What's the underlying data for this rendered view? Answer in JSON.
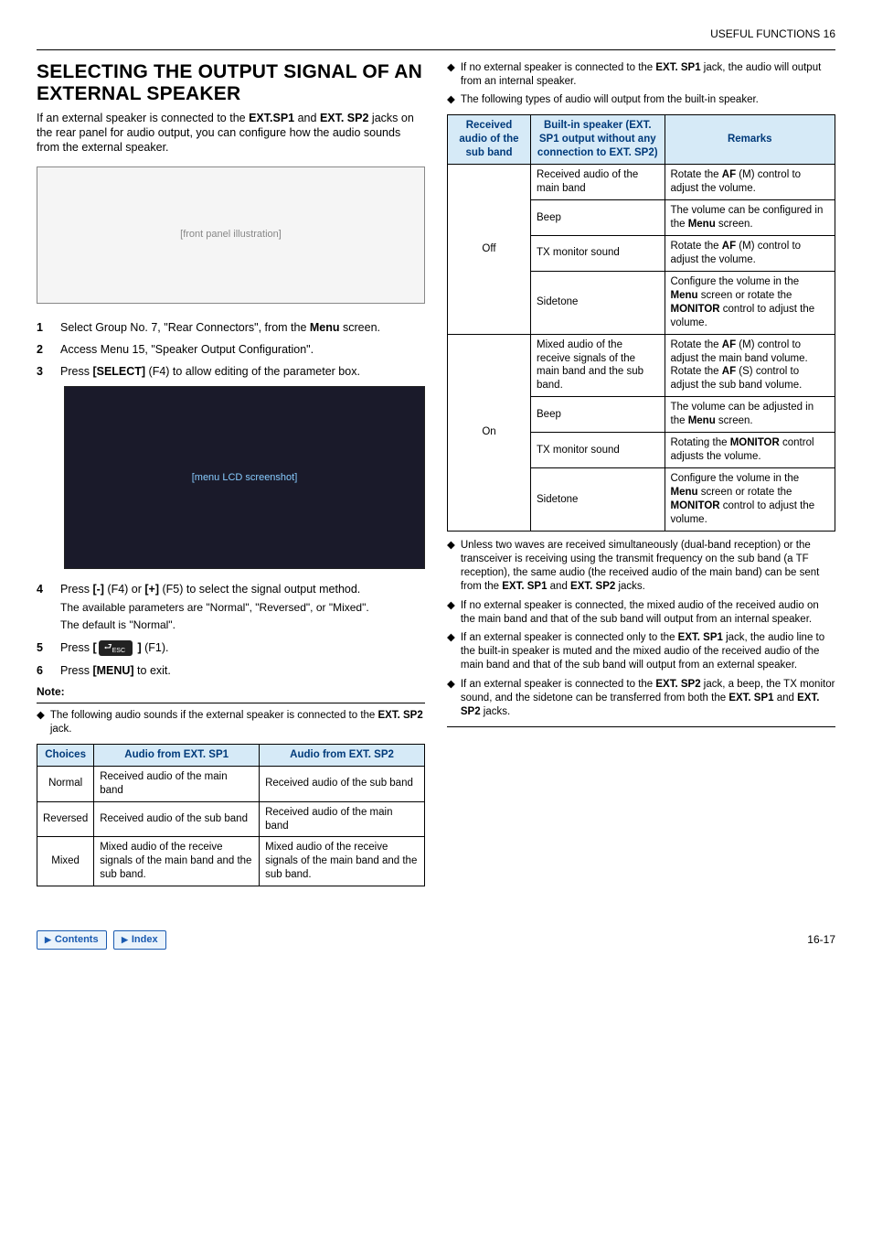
{
  "header": {
    "breadcrumb": "USEFUL FUNCTIONS 16"
  },
  "section_title": "SELECTING THE OUTPUT SIGNAL OF AN EXTERNAL SPEAKER",
  "intro": {
    "p1_a": "If an external speaker is connected to the ",
    "p1_b": "EXT.SP1",
    "p1_c": " and ",
    "p1_d": "EXT. SP2",
    "p1_e": " jacks on the rear panel for audio output, you can configure how the audio sounds from the external speaker."
  },
  "placeholders": {
    "panel": "[front panel illustration]",
    "lcd": "[menu LCD screenshot]"
  },
  "steps": [
    {
      "n": "1",
      "t_a": "Select Group No. 7, \"Rear Connectors\", from the ",
      "t_b": "Menu",
      "t_c": " screen."
    },
    {
      "n": "2",
      "t_a": "Access Menu 15, \"Speaker Output Configuration\"."
    },
    {
      "n": "3",
      "t_a": "Press ",
      "t_b": "[SELECT]",
      "t_c": " (F4) to allow editing of the parameter box."
    },
    {
      "n": "4",
      "t_a": "Press ",
      "t_b": "[-]",
      "t_c": " (F4) or ",
      "t_d": "[+]",
      "t_e": " (F5) to select the signal output method.",
      "sub1": "The available parameters are \"Normal\", \"Reversed\", or \"Mixed\".",
      "sub2": "The default is \"Normal\"."
    },
    {
      "n": "5",
      "t_a": "Press ",
      "t_b": "[",
      "t_c": " ]",
      "t_d": " (F1)."
    },
    {
      "n": "6",
      "t_a": "Press ",
      "t_b": "[MENU]",
      "t_c": " to exit."
    }
  ],
  "note_label": "Note:",
  "note_left": {
    "a": "The following audio sounds if the external speaker is connected to the ",
    "b": "EXT. SP2",
    "c": " jack."
  },
  "table1": {
    "h1": "Choices",
    "h2": "Audio from EXT. SP1",
    "h3": "Audio from EXT. SP2",
    "rows": [
      {
        "c1": "Normal",
        "c2": "Received audio of the main band",
        "c3": "Received audio of the sub band"
      },
      {
        "c1": "Reversed",
        "c2": "Received audio of the sub band",
        "c3": "Received audio of the main band"
      },
      {
        "c1": "Mixed",
        "c2": "Mixed audio of the receive signals of the main band and the sub band.",
        "c3": "Mixed audio of the receive signals of the main band and the sub band."
      }
    ]
  },
  "right_bullets_top": [
    {
      "a": "If no external speaker is connected to the ",
      "b": "EXT. SP1",
      "c": " jack, the audio will output from an internal speaker."
    },
    {
      "a": "The following types of audio will output from the built-in speaker."
    }
  ],
  "table2": {
    "h1": "Received audio of the sub band",
    "h2": "Built-in speaker (EXT. SP1 output without any connection to EXT. SP2)",
    "h3": "Remarks",
    "groups": [
      {
        "label": "Off",
        "rows": [
          {
            "c2": "Received audio of the main band",
            "r": {
              "a": "Rotate the ",
              "b": "AF",
              "c": " (M) control to adjust the volume."
            }
          },
          {
            "c2": "Beep",
            "r": {
              "a": "The volume can be configured in the ",
              "b": "Menu",
              "c": " screen."
            }
          },
          {
            "c2": "TX monitor sound",
            "r": {
              "a": "Rotate the ",
              "b": "AF",
              "c": " (M) control to adjust the volume."
            }
          },
          {
            "c2": "Sidetone",
            "r": {
              "a": "Configure the volume in the ",
              "b": "Menu",
              "c": " screen or rotate the ",
              "d": "MONITOR",
              "e": " control to adjust the volume."
            }
          }
        ]
      },
      {
        "label": "On",
        "rows": [
          {
            "c2": "Mixed audio of the receive signals of the main band and the sub band.",
            "r": {
              "a": "Rotate the ",
              "b": "AF",
              "c": " (M) control to adjust the main band volume. Rotate the ",
              "d": "AF",
              "e": " (S) control to adjust the sub band volume."
            }
          },
          {
            "c2": "Beep",
            "r": {
              "a": "The volume can be adjusted in the ",
              "b": "Menu",
              "c": " screen."
            }
          },
          {
            "c2": "TX monitor sound",
            "r": {
              "a": "Rotating the ",
              "b": "MONITOR",
              "c": " control adjusts the volume."
            }
          },
          {
            "c2": "Sidetone",
            "r": {
              "a": "Configure the volume in the ",
              "b": "Menu",
              "c": " screen or rotate the ",
              "d": "MONITOR",
              "e": " control to adjust the volume."
            }
          }
        ]
      }
    ]
  },
  "right_bullets_bottom": [
    {
      "a": "Unless two waves are received simultaneously (dual-band reception) or the transceiver is receiving using the transmit frequency on the sub band (a TF reception), the same audio (the received audio of the main band) can be sent from the ",
      "b": "EXT. SP1",
      "c": " and ",
      "d": "EXT. SP2",
      "e": " jacks."
    },
    {
      "a": "If no external speaker is connected, the mixed audio of the received audio on the main band and that of the sub band will output from an internal speaker."
    },
    {
      "a": "If an external speaker is connected only to the ",
      "b": "EXT. SP1",
      "c": " jack, the audio line to the built-in speaker is muted and the mixed audio of the received audio of the main band and that of the sub band will output from an external speaker."
    },
    {
      "a": "If an external speaker is connected to the ",
      "b": "EXT. SP2",
      "c": " jack, a beep, the TX monitor sound, and the sidetone can be transferred from both the ",
      "d": "EXT. SP1",
      "e": " and ",
      "f": "EXT. SP2",
      "g": " jacks."
    }
  ],
  "footer": {
    "contents": "Contents",
    "index": "Index",
    "page": "16-17"
  }
}
